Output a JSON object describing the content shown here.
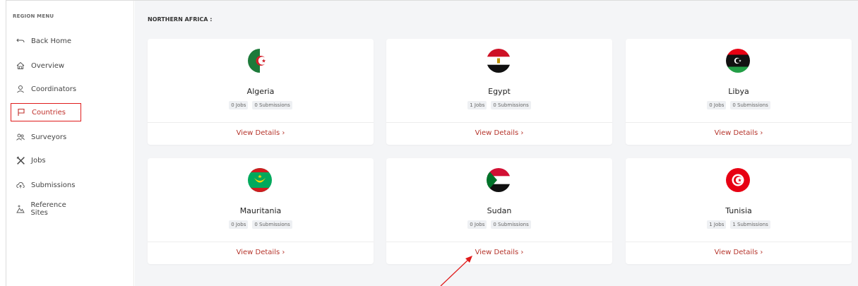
{
  "sidebar": {
    "heading": "REGION MENU",
    "items": [
      {
        "label": "Back Home",
        "icon": "back-arrow-icon"
      },
      {
        "label": "Overview",
        "icon": "home-icon"
      },
      {
        "label": "Coordinators",
        "icon": "user-icon"
      },
      {
        "label": "Countries",
        "icon": "flag-icon",
        "active": true
      },
      {
        "label": "Surveyors",
        "icon": "users-icon"
      },
      {
        "label": "Jobs",
        "icon": "tools-icon"
      },
      {
        "label": "Submissions",
        "icon": "cloud-upload-icon"
      },
      {
        "label": "Reference Sites",
        "icon": "map-pin-icon"
      }
    ]
  },
  "main": {
    "section_title": "NORTHERN AFRICA :",
    "cards": [
      {
        "name": "Algeria",
        "jobs": "0 Jobs",
        "submissions": "0 Submissions",
        "link": "View Details ›",
        "flag": "algeria"
      },
      {
        "name": "Egypt",
        "jobs": "1 Jobs",
        "submissions": "0 Submissions",
        "link": "View Details ›",
        "flag": "egypt"
      },
      {
        "name": "Libya",
        "jobs": "0 Jobs",
        "submissions": "0 Submissions",
        "link": "View Details ›",
        "flag": "libya"
      },
      {
        "name": "Mauritania",
        "jobs": "0 Jobs",
        "submissions": "0 Submissions",
        "link": "View Details ›",
        "flag": "mauritania"
      },
      {
        "name": "Sudan",
        "jobs": "0 Jobs",
        "submissions": "0 Submissions",
        "link": "View Details ›",
        "flag": "sudan"
      },
      {
        "name": "Tunisia",
        "jobs": "1 Jobs",
        "submissions": "1 Submissions",
        "link": "View Details ›",
        "flag": "tunisia"
      }
    ]
  },
  "colors": {
    "accent": "#b5342b",
    "highlight_box": "#e01c1c",
    "annotation_arrow": "#e01c1c",
    "background": "#f4f5f7"
  }
}
